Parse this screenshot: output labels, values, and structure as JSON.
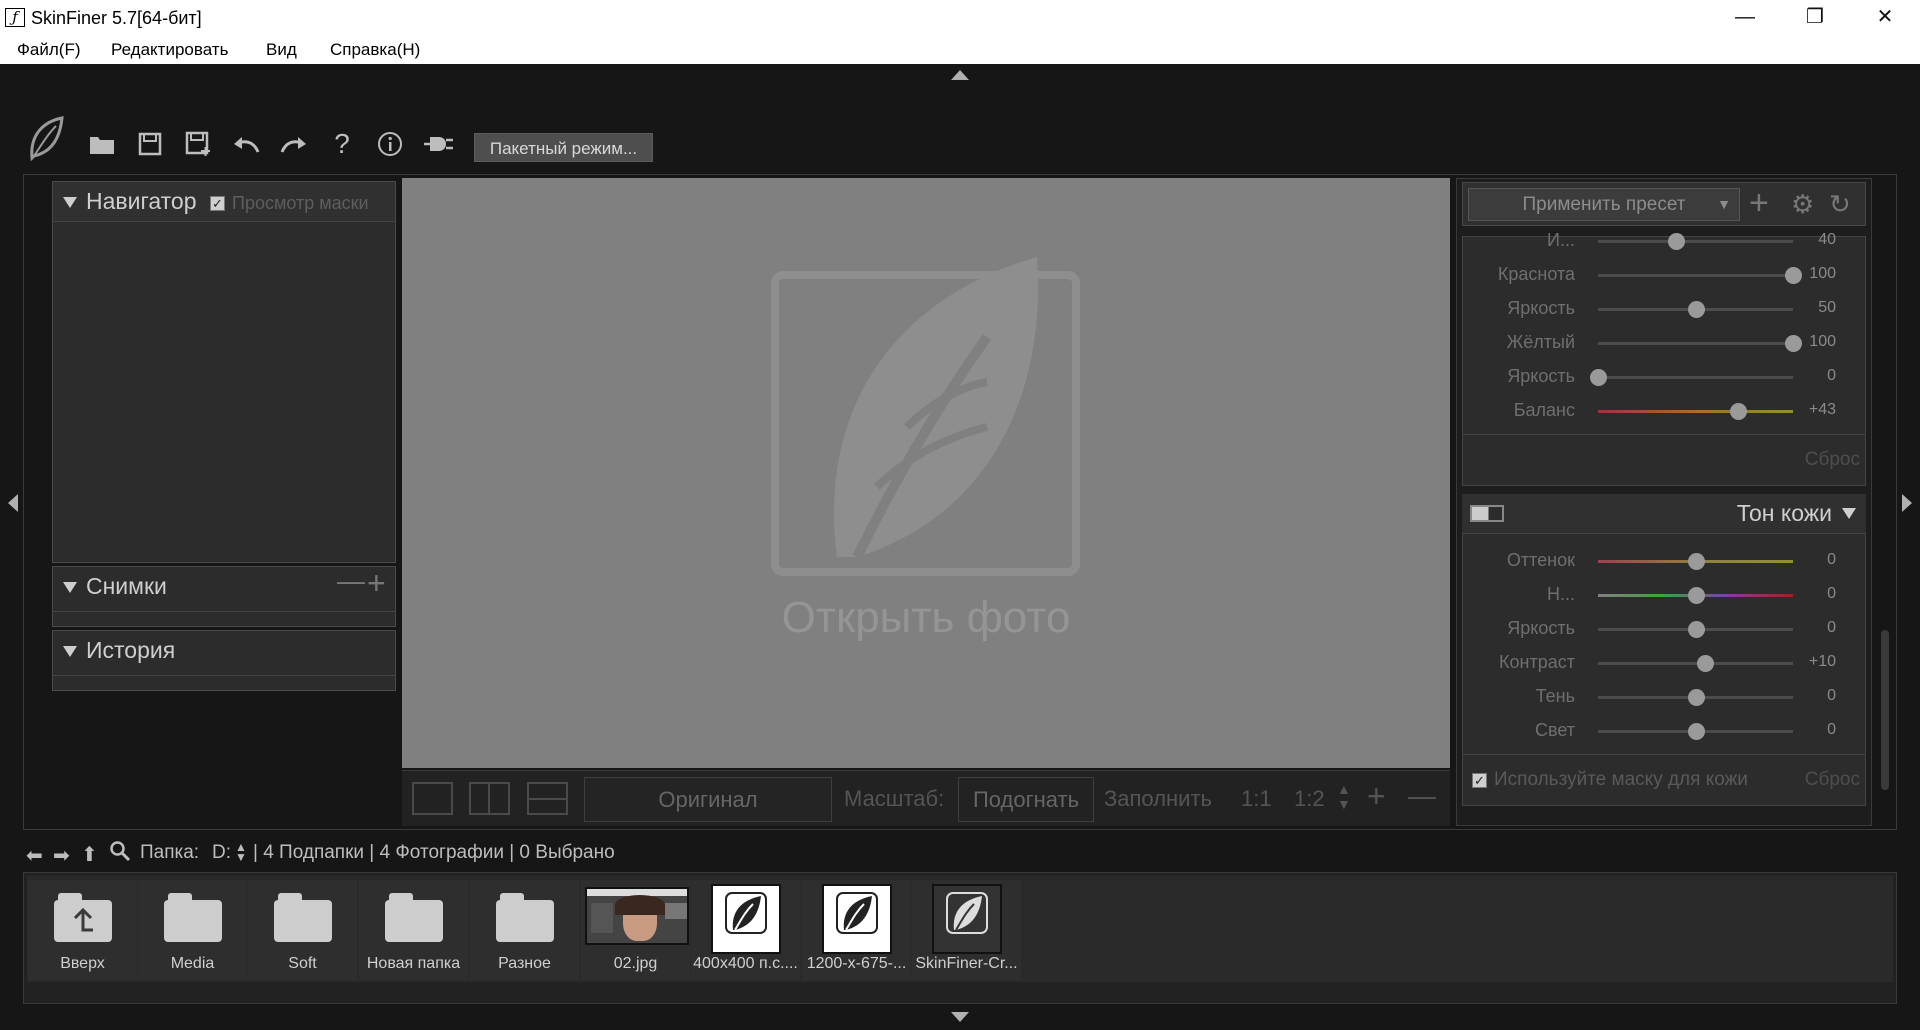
{
  "window": {
    "title": "SkinFiner 5.7[64-бит]",
    "icon": "skinfiner-logo-icon"
  },
  "menu": [
    "Файл(F)",
    "Редактировать",
    "Вид",
    "Справка(H)"
  ],
  "toolbar": {
    "icons": [
      "skinfiner-logo-icon",
      "open-folder-icon",
      "save-icon",
      "save-as-icon",
      "undo-icon",
      "redo-icon",
      "help-icon",
      "info-icon",
      "plugin-icon"
    ],
    "batch_label": "Пакетный режим..."
  },
  "left_panel": {
    "navigator_title": "Навигатор",
    "mask_preview_label": "Просмотр маски",
    "mask_preview_checked": true,
    "snapshots_title": "Снимки",
    "history_title": "История"
  },
  "canvas": {
    "placeholder": "Открыть фото",
    "background": "#808080"
  },
  "view_bar": {
    "original_label": "Оригинал",
    "scale_label": "Масштаб:",
    "fit_label": "Подогнать",
    "fill_label": "Заполнить",
    "ratio_1_1": "1:1",
    "ratio_1_2": "1:2"
  },
  "right_panel": {
    "preset_label": "Применить пресет",
    "upper_sliders": [
      {
        "label": "И...",
        "value": "40",
        "pos": 0.4
      },
      {
        "label": "Краснота",
        "value": "100",
        "pos": 1.0
      },
      {
        "label": "Яркость",
        "value": "50",
        "pos": 0.5
      },
      {
        "label": "Жёлтый",
        "value": "100",
        "pos": 1.0
      },
      {
        "label": "Яркость",
        "value": "0",
        "pos": 0.0
      },
      {
        "label": "Баланс",
        "value": "+43",
        "pos": 0.72
      }
    ],
    "upper_reset": "Сброс",
    "skin_tone": {
      "title": "Тон кожи",
      "sliders": [
        {
          "label": "Оттенок",
          "value": "0",
          "pos": 0.5
        },
        {
          "label": "Н...",
          "value": "0",
          "pos": 0.5
        },
        {
          "label": "Яркость",
          "value": "0",
          "pos": 0.5
        },
        {
          "label": "Контраст",
          "value": "+10",
          "pos": 0.55
        },
        {
          "label": "Тень",
          "value": "0",
          "pos": 0.5
        },
        {
          "label": "Свет",
          "value": "0",
          "pos": 0.5
        }
      ],
      "mask_label": "Используйте маску для кожи",
      "mask_checked": true,
      "reset": "Сброс"
    }
  },
  "browser": {
    "folder_label": "Папка:",
    "drive": "D:",
    "status": "| 4 Подпапки | 4 Фотографии | 0 Выбрано"
  },
  "files": [
    {
      "name": "Вверх",
      "kind": "up"
    },
    {
      "name": "Media",
      "kind": "folder"
    },
    {
      "name": "Soft",
      "kind": "folder"
    },
    {
      "name": "Новая папка",
      "kind": "folder"
    },
    {
      "name": "Разное",
      "kind": "folder"
    },
    {
      "name": "02.jpg",
      "kind": "photo"
    },
    {
      "name": "400x400 п.с....",
      "kind": "logo"
    },
    {
      "name": "1200-x-675-...",
      "kind": "logo"
    },
    {
      "name": "SkinFiner-Cr...",
      "kind": "logo-dark"
    }
  ],
  "colors": {
    "accent": "#808080",
    "bg": "#161616",
    "panel": "#2c2c2c"
  }
}
